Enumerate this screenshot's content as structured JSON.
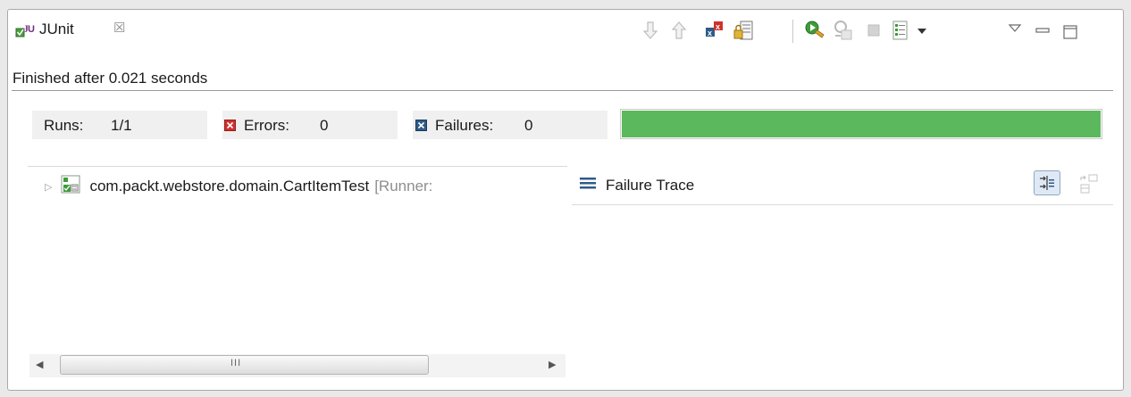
{
  "view": {
    "title": "JUnit",
    "close_glyph": "☒",
    "status": "Finished after 0.021 seconds"
  },
  "toolbar": {
    "items": [
      {
        "name": "next-failure-icon"
      },
      {
        "name": "previous-failure-icon"
      },
      {
        "name": "show-failures-only-icon"
      },
      {
        "name": "scroll-lock-icon"
      },
      {
        "name": "rerun-test-icon"
      },
      {
        "name": "rerun-failed-first-icon"
      },
      {
        "name": "stop-icon"
      },
      {
        "name": "test-run-history-icon"
      },
      {
        "name": "history-dropdown-icon"
      },
      {
        "name": "view-menu-icon"
      },
      {
        "name": "minimize-icon"
      },
      {
        "name": "maximize-icon"
      }
    ]
  },
  "counters": {
    "runs_label": "Runs:",
    "runs_value": "1/1",
    "errors_label": "Errors:",
    "errors_value": "0",
    "failures_label": "Failures:",
    "failures_value": "0"
  },
  "progress": {
    "fraction": 1.0,
    "color": "#5cb85c"
  },
  "tree": {
    "expand_glyph": "▷",
    "label": "com.packt.webstore.domain.CartItemTest",
    "runner": "[Runner:"
  },
  "trace": {
    "title": "Failure Trace"
  },
  "scrollbar": {
    "left_arrow": "◀",
    "right_arrow": "▶",
    "grip": "III"
  },
  "colors": {
    "progress_green": "#5cb85c",
    "error_red": "#d0312d",
    "failure_blue": "#2f5b88"
  }
}
